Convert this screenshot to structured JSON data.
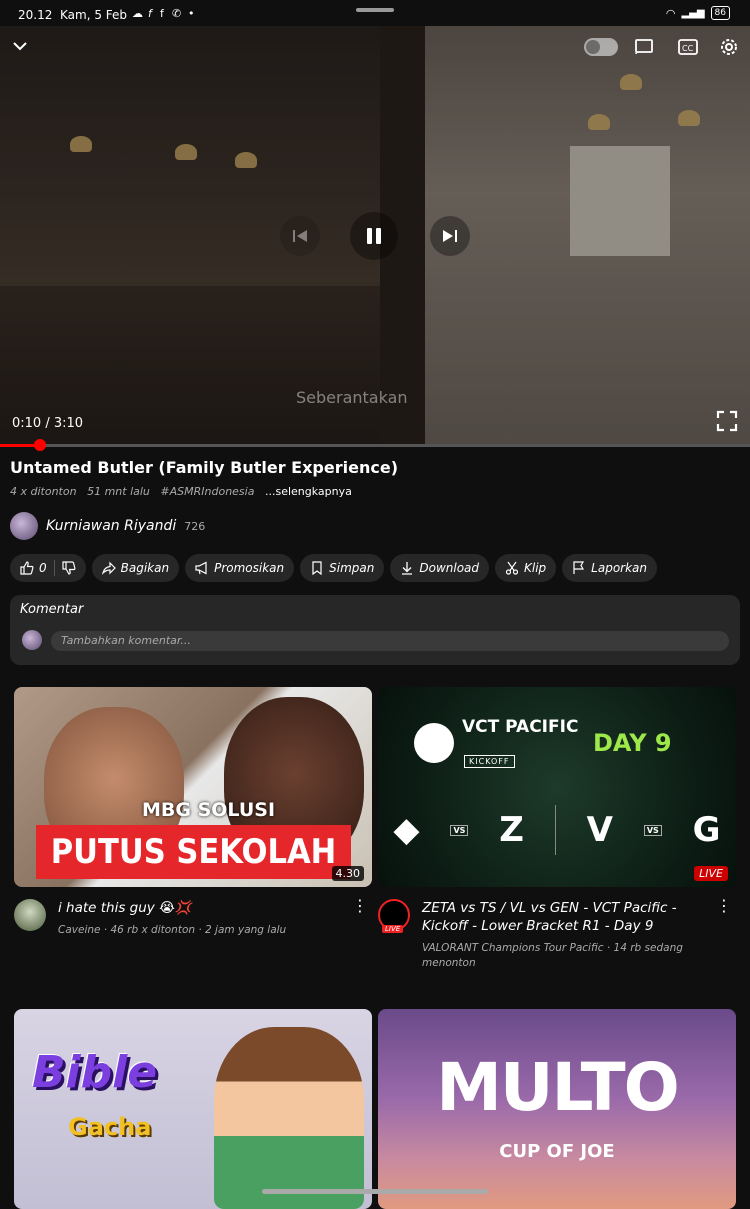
{
  "status_bar": {
    "time": "20.12",
    "date": "Kam, 5 Feb",
    "battery": "86",
    "dot": "•"
  },
  "player": {
    "watermark": "Seberantakan",
    "current_time": "0:10",
    "duration": "3:10",
    "timecode": "0:10 / 3:10",
    "progress": 0.053
  },
  "video": {
    "title": "Untamed Butler (Family Butler Experience)",
    "views": "4 x ditonton",
    "age": "51 mnt lalu",
    "hashtag": "#ASMRIndonesia",
    "more": "...selengkapnya"
  },
  "channel": {
    "name": "Kurniawan Riyandi",
    "subs": "726"
  },
  "actions": {
    "likes": "0",
    "share": "Bagikan",
    "promote": "Promosikan",
    "save": "Simpan",
    "download": "Download",
    "clip": "Klip",
    "report": "Laporkan"
  },
  "comments": {
    "header": "Komentar",
    "placeholder": "Tambahkan komentar..."
  },
  "feed": [
    {
      "thumb_subtitle": "MBG SOLUSI",
      "thumb_banner": "PUTUS SEKOLAH",
      "duration": "4.30",
      "title": "i hate this guy 😭💢",
      "channel": "Caveine",
      "views": "46 rb x ditonton",
      "age": "2 jam yang lalu",
      "stats": "Caveine · 46 rb x ditonton · 2 jam yang lalu"
    },
    {
      "thumb_brand": "VCT PACIFIC",
      "thumb_kickoff": "KICKOFF",
      "thumb_day": "DAY 9",
      "thumb_vs": "VS",
      "live_badge": "LIVE",
      "avatar_badge": "LIVE",
      "title": "ZETA vs TS / VL vs GEN - VCT Pacific - Kickoff - Lower Bracket R1 - Day 9",
      "stats": "VALORANT Champions Tour Pacific · 14 rb sedang menonton"
    },
    {
      "thumb_title": "Bible",
      "thumb_subtitle": "Gacha"
    },
    {
      "thumb_title": "MULTO",
      "thumb_subtitle": "CUP OF JOE"
    }
  ],
  "colors": {
    "background": "#0f0f0f",
    "chip": "#272727",
    "accent": "#ff0000",
    "live": "#cc0000",
    "vct_day": "#9ee84a"
  }
}
